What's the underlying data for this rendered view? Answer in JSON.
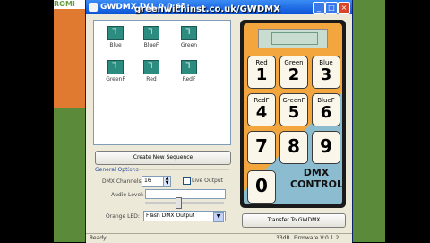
{
  "desktop": {
    "logo_text": "ROMI"
  },
  "window": {
    "title": "GWDMX [V1.0.0.6]",
    "min": "_",
    "max": "□",
    "close": "×"
  },
  "overlay_url": "greenwichinst.co.uk/GWDMX",
  "channels": [
    {
      "label": "Blue",
      "icon": "channel-icon"
    },
    {
      "label": "BlueF",
      "icon": "channel-icon"
    },
    {
      "label": "Green",
      "icon": "channel-icon"
    },
    {
      "label": "GreenF",
      "icon": "channel-icon"
    },
    {
      "label": "Red",
      "icon": "channel-icon"
    },
    {
      "label": "RedF",
      "icon": "channel-icon"
    }
  ],
  "buttons": {
    "create": "Create New Sequence",
    "transfer": "Transfer To GWDMX"
  },
  "options": {
    "title": "General Options",
    "channels_label": "DMX Channels:",
    "channels_value": "16",
    "live_label": "Live Output",
    "audio_label": "Audio Level:",
    "orange_label": "Orange LED:",
    "orange_value": "Flash DMX Output"
  },
  "keypad": {
    "keys": [
      {
        "label": "Red",
        "digit": "1"
      },
      {
        "label": "Green",
        "digit": "2"
      },
      {
        "label": "Blue",
        "digit": "3"
      },
      {
        "label": "RedF",
        "digit": "4"
      },
      {
        "label": "GreenF",
        "digit": "5"
      },
      {
        "label": "BlueF",
        "digit": "6"
      },
      {
        "label": "",
        "digit": "7"
      },
      {
        "label": "",
        "digit": "8"
      },
      {
        "label": "",
        "digit": "9"
      },
      {
        "label": "",
        "digit": "0"
      }
    ],
    "dmx_line1": "DMX",
    "dmx_line2": "CONTROL"
  },
  "status": {
    "text": "Ready",
    "mid": "33dB",
    "firmware": "Firmware V:0.1.2"
  },
  "colors": {
    "accent": "#0a52d6",
    "keypad_orange": "#f4a63e",
    "tile_teal": "#2c8c7f"
  }
}
